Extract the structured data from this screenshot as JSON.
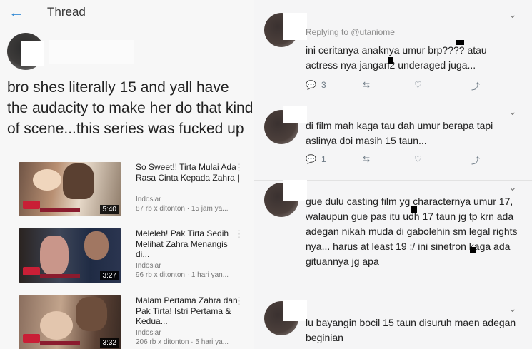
{
  "left": {
    "back_icon": "arrow-left-icon",
    "title": "Thread",
    "post_text": "bro shes literally 15 and yall have the audacity to make her do that kind of scene...this series was fucked up",
    "videos": [
      {
        "title": "So Sweet!! Tirta Mulai Ada Rasa Cinta Kepada Zahra |",
        "channel": "Indosiar",
        "meta": "87 rb x ditonton · 15 jam ya...",
        "duration": "5:40",
        "menu": "⋮"
      },
      {
        "title": "Meleleh! Pak Tirta Sedih Melihat Zahra Menangis di...",
        "channel": "Indosiar",
        "meta": "96 rb x ditonton · 1 hari yan...",
        "duration": "3:27",
        "menu": "⋮"
      },
      {
        "title": "Malam Pertama Zahra dan Pak Tirta! Istri Pertama & Kedua...",
        "channel": "Indosiar",
        "meta": "206 rb x ditonton · 5 hari ya...",
        "duration": "3:32",
        "menu": "⋮"
      }
    ]
  },
  "right": {
    "replies": [
      {
        "replying_to": "Replying to @utaniome",
        "text": "ini ceritanya anaknya umur brp???? atau actress nya jangan2 underaged juga...",
        "reply_count": "3",
        "retweet_count": "",
        "chevron": "⌄"
      },
      {
        "text": "di film mah kaga tau dah umur berapa tapi aslinya doi masih 15 taun...",
        "reply_count": "1",
        "retweet_count": "",
        "chevron": "⌄"
      },
      {
        "text": "gue dulu casting film yg characternya umur 17, walaupun gue pas itu udh 17 taun jg tp krn ada adegan nikah muda di gabolehin sm legal rights nya... harus at least 19 :/ ini sinetron kaga ada gituannya jg apa",
        "chevron": "⌄"
      },
      {
        "text": "lu bayangin bocil 15 taun disuruh maen adegan beginian",
        "chevron": "⌄"
      }
    ]
  },
  "colors": {
    "accent": "#3b8fd6",
    "badge": "#c91f36",
    "text": "#222222"
  }
}
